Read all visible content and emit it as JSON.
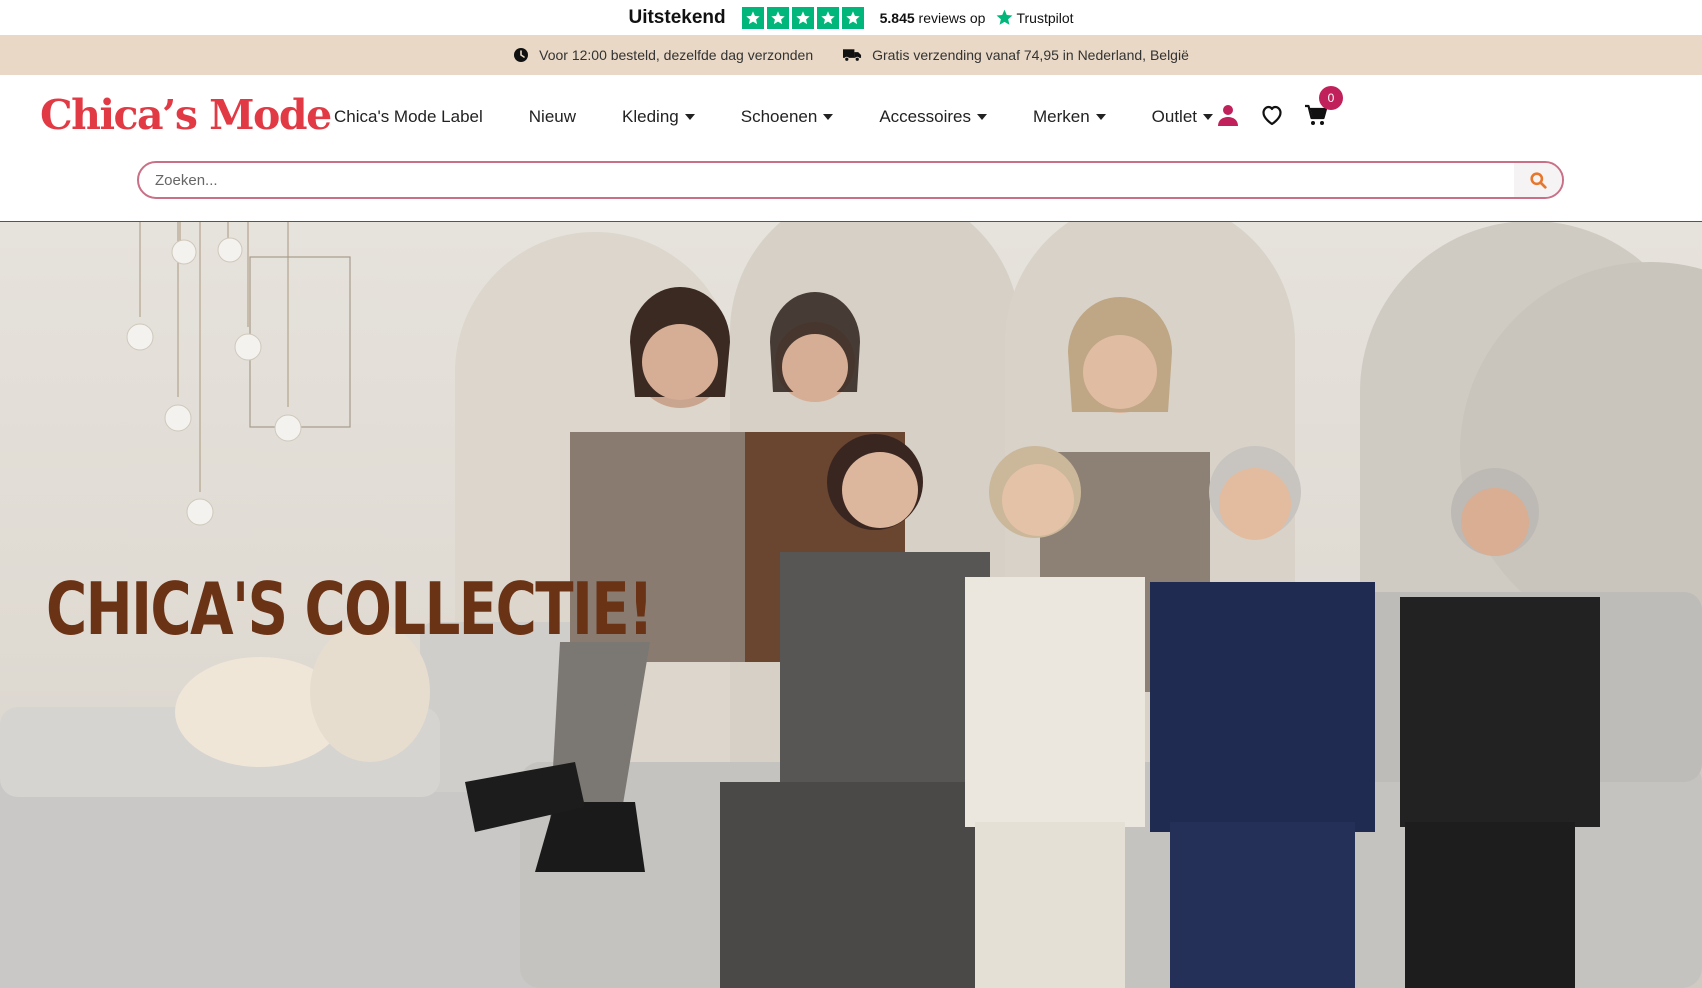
{
  "trustpilot": {
    "rating_label": "Uitstekend",
    "stars": 5,
    "reviews_count": "5.845",
    "reviews_suffix": "reviews op",
    "brand": "Trustpilot",
    "star_color": "#00b67a"
  },
  "info_bar": {
    "items": [
      {
        "icon": "clock-icon",
        "text": "Voor 12:00 besteld, dezelfde dag verzonden"
      },
      {
        "icon": "truck-icon",
        "text": "Gratis verzending vanaf 74,95 in Nederland, België"
      }
    ],
    "background": "#e9d8c5"
  },
  "header": {
    "logo": "Chica’s Mode",
    "logo_color": "#e23a44",
    "nav": [
      {
        "label": "Chica's Mode Label",
        "has_dropdown": false
      },
      {
        "label": "Nieuw",
        "has_dropdown": false
      },
      {
        "label": "Kleding",
        "has_dropdown": true
      },
      {
        "label": "Schoenen",
        "has_dropdown": true
      },
      {
        "label": "Accessoires",
        "has_dropdown": true
      },
      {
        "label": "Merken",
        "has_dropdown": true
      },
      {
        "label": "Outlet",
        "has_dropdown": true
      }
    ],
    "icons": [
      "user-icon",
      "heart-icon",
      "cart-icon"
    ],
    "cart_count": "0",
    "accent": "#c0215a"
  },
  "search": {
    "placeholder": "Zoeken...",
    "value": "",
    "button_icon": "search-icon",
    "button_icon_color": "#e8772e"
  },
  "hero": {
    "title": "CHICA'S COLLECTIE!",
    "title_color": "#6b3316",
    "image_description_icon": "group-photo"
  }
}
